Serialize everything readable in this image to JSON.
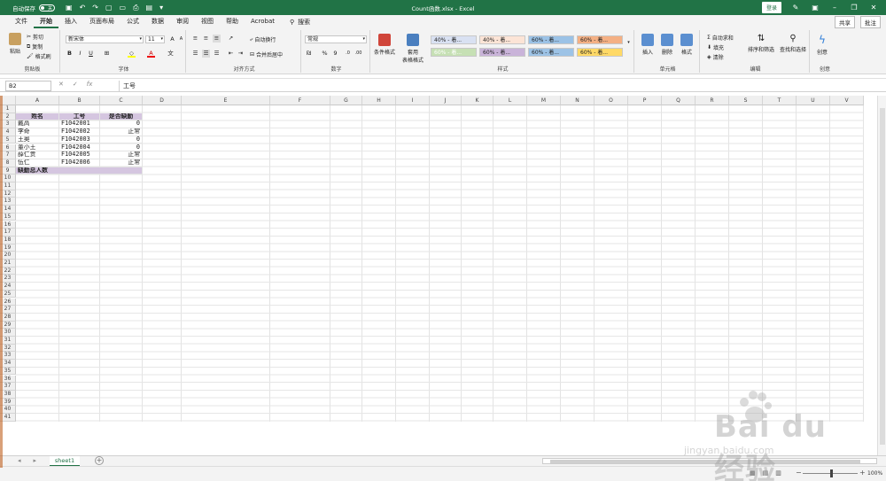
{
  "titlebar": {
    "autosave_label": "自动保存",
    "autosave_state": "关",
    "doc_title": "Count函数.xlsx  -  Excel",
    "login_label": "登录"
  },
  "menu": {
    "tabs": [
      "文件",
      "开始",
      "插入",
      "页面布局",
      "公式",
      "数据",
      "审阅",
      "视图",
      "帮助",
      "Acrobat"
    ],
    "active_tab": "开始",
    "search_label": "搜索",
    "share_label": "共享",
    "comment_label": "批注"
  },
  "ribbon": {
    "clipboard": {
      "label": "剪贴板",
      "paste": "粘贴",
      "cut": "剪切",
      "copy": "复制",
      "format_painter": "格式刷"
    },
    "font": {
      "label": "字体",
      "font_name": "新宋体",
      "font_size": "11"
    },
    "alignment": {
      "label": "对齐方式",
      "wrap": "自动换行",
      "merge": "合并后居中"
    },
    "number": {
      "label": "数字",
      "format": "常规"
    },
    "styles": {
      "label": "样式",
      "conditional": "条件格式",
      "table_format": "套用\n表格格式",
      "cells": [
        {
          "text": "40% - 着...",
          "color": "#d9e1f2"
        },
        {
          "text": "40% - 着...",
          "color": "#fce4d6"
        },
        {
          "text": "60% - 着...",
          "color": "#9bc2e6"
        },
        {
          "text": "60% - 着...",
          "color": "#f4b084"
        },
        {
          "text": "60% - 着...",
          "color": "#c6e0b4"
        },
        {
          "text": "60% - 着...",
          "color": "#c9b3d9"
        },
        {
          "text": "60% - 着...",
          "color": "#9dc3e6"
        },
        {
          "text": "60% - 着...",
          "color": "#ffd966"
        }
      ]
    },
    "cells_group": {
      "label": "单元格",
      "insert": "插入",
      "delete": "删除",
      "format": "格式"
    },
    "editing": {
      "label": "编辑",
      "autosum": "自动求和",
      "fill": "填充",
      "clear": "清除",
      "sort": "排序和筛选",
      "find": "查找和选择"
    },
    "ideas": {
      "label": "创意",
      "text": "创意"
    }
  },
  "formula_bar": {
    "name_box": "B2",
    "content": "工号"
  },
  "columns": [
    "A",
    "B",
    "C",
    "D",
    "E",
    "F",
    "G",
    "H",
    "I",
    "J",
    "K",
    "L",
    "M",
    "N",
    "O",
    "P",
    "Q",
    "R",
    "S",
    "T",
    "U",
    "V"
  ],
  "rows": [
    "1",
    "2",
    "3",
    "4",
    "5",
    "6",
    "7",
    "8",
    "9",
    "10",
    "11",
    "12",
    "13",
    "14",
    "15",
    "16",
    "17",
    "18",
    "19",
    "20",
    "21",
    "22",
    "23",
    "24",
    "25",
    "26",
    "27",
    "28",
    "29",
    "30",
    "31",
    "32",
    "33",
    "34",
    "35",
    "36",
    "37",
    "38",
    "39",
    "40",
    "41"
  ],
  "table": {
    "headers": [
      "姓名",
      "工号",
      "是否缺勤"
    ],
    "rows": [
      [
        "戴高",
        "F1042001",
        "0"
      ],
      [
        "李奇",
        "F1042002",
        "正常"
      ],
      [
        "王奥",
        "F1042003",
        "0"
      ],
      [
        "董小王",
        "F1042004",
        "0"
      ],
      [
        "薛仁贵",
        "F1042005",
        "正常"
      ],
      [
        "伍仁",
        "F1042006",
        "正常"
      ]
    ],
    "summary_label": "缺勤总人数"
  },
  "sheets": {
    "tabs": [
      "sheet1"
    ]
  },
  "status": {
    "zoom": "100%"
  },
  "watermark": {
    "brand": "Bai du 经验",
    "url": "jingyan.baidu.com"
  }
}
